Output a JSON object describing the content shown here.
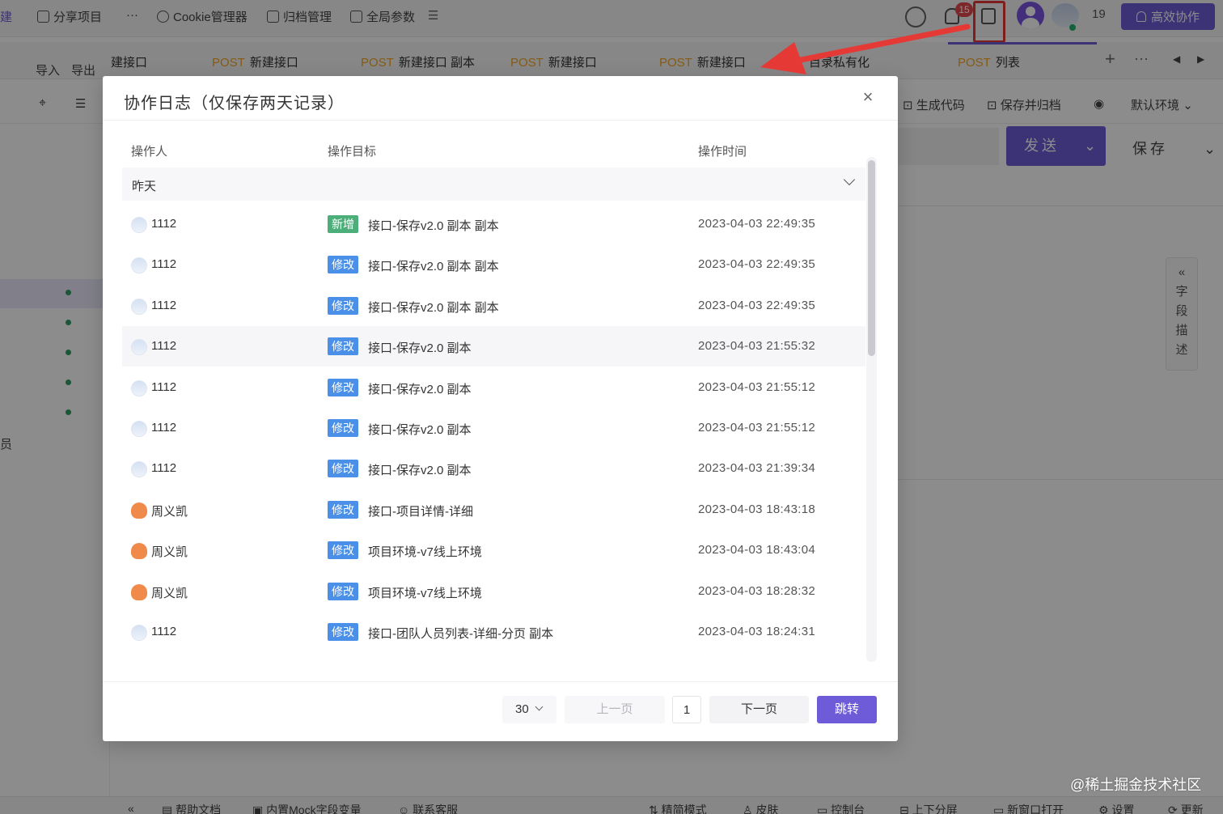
{
  "topbar": {
    "left_cut": "建",
    "share": "分享项目",
    "more": "···",
    "cookie": "Cookie管理器",
    "archive": "归档管理",
    "global_params": "全局参数",
    "menu_glyph": "☰",
    "notification_count": "15",
    "member_count": "19",
    "collab_button": "高效协作"
  },
  "tabs": {
    "t0": "建接口",
    "t1_method": "POST",
    "t1": "新建接口",
    "t2_method": "POST",
    "t2": "新建接口 副本",
    "t3_method": "POST",
    "t3": "新建接口",
    "t4_method": "POST",
    "t4": "新建接口",
    "t5": "目录私有化",
    "t6_method": "POST",
    "t6": "列表",
    "add": "+",
    "more": "···",
    "prev": "◀",
    "next": "▶"
  },
  "sidebar": {
    "import": "导入",
    "export": "导出",
    "member_cut": "员"
  },
  "toolbar2": {
    "gen_code": "生成代码",
    "save_archive": "保存并归档",
    "env": "默认环境",
    "send": "发送",
    "save": "保存"
  },
  "right_panel": {
    "chars": [
      "字",
      "段",
      "描",
      "述"
    ],
    "collapse": "«"
  },
  "modal": {
    "title": "协作日志（仅保存两天记录）",
    "close": "×",
    "columns": {
      "operator": "操作人",
      "target": "操作目标",
      "time": "操作时间"
    },
    "group": "昨天",
    "rows": [
      {
        "user": "1112",
        "avatar": "cloud",
        "tag": "新增",
        "tag_type": "add",
        "target": "接口-保存v2.0 副本 副本",
        "time": "2023-04-03 22:49:35"
      },
      {
        "user": "1112",
        "avatar": "cloud",
        "tag": "修改",
        "tag_type": "mod",
        "target": "接口-保存v2.0 副本 副本",
        "time": "2023-04-03 22:49:35"
      },
      {
        "user": "1112",
        "avatar": "cloud",
        "tag": "修改",
        "tag_type": "mod",
        "target": "接口-保存v2.0 副本 副本",
        "time": "2023-04-03 22:49:35"
      },
      {
        "user": "1112",
        "avatar": "cloud",
        "tag": "修改",
        "tag_type": "mod",
        "target": "接口-保存v2.0 副本",
        "time": "2023-04-03 21:55:32"
      },
      {
        "user": "1112",
        "avatar": "cloud",
        "tag": "修改",
        "tag_type": "mod",
        "target": "接口-保存v2.0 副本",
        "time": "2023-04-03 21:55:12"
      },
      {
        "user": "1112",
        "avatar": "cloud",
        "tag": "修改",
        "tag_type": "mod",
        "target": "接口-保存v2.0 副本",
        "time": "2023-04-03 21:55:12"
      },
      {
        "user": "1112",
        "avatar": "cloud",
        "tag": "修改",
        "tag_type": "mod",
        "target": "接口-保存v2.0 副本",
        "time": "2023-04-03 21:39:34"
      },
      {
        "user": "周义凯",
        "avatar": "squid",
        "tag": "修改",
        "tag_type": "mod",
        "target": "接口-项目详情-详细",
        "time": "2023-04-03 18:43:18"
      },
      {
        "user": "周义凯",
        "avatar": "squid",
        "tag": "修改",
        "tag_type": "mod",
        "target": "项目环境-v7线上环境",
        "time": "2023-04-03 18:43:04"
      },
      {
        "user": "周义凯",
        "avatar": "squid",
        "tag": "修改",
        "tag_type": "mod",
        "target": "项目环境-v7线上环境",
        "time": "2023-04-03 18:28:32"
      },
      {
        "user": "1112",
        "avatar": "cloud",
        "tag": "修改",
        "tag_type": "mod",
        "target": "接口-团队人员列表-详细-分页 副本",
        "time": "2023-04-03 18:24:31"
      }
    ],
    "pager": {
      "page_size": "30",
      "prev": "上一页",
      "page": "1",
      "next": "下一页",
      "jump": "跳转"
    }
  },
  "footer": {
    "collapse": "«",
    "help": "帮助文档",
    "mock": "内置Mock字段变量",
    "support": "联系客服",
    "mode": "精简模式",
    "skin": "皮肤",
    "console": "控制台",
    "split": "上下分屏",
    "new_window": "新窗口打开",
    "settings": "设置",
    "update": "更新"
  },
  "watermark": "@稀土掘金技术社区",
  "colors": {
    "accent": "#6e5bd8",
    "tag_add": "#4caf7a",
    "tag_mod": "#4a90e8",
    "badge": "#e5484d",
    "annotation": "#e53935"
  }
}
